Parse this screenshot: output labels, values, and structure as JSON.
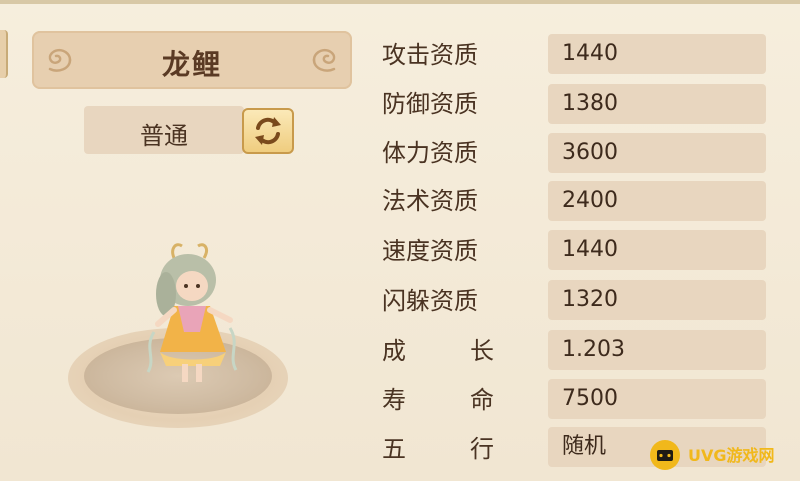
{
  "pet": {
    "name": "龙鲤",
    "quality": "普通"
  },
  "stats": [
    {
      "label": "攻击资质",
      "value": "1440"
    },
    {
      "label": "防御资质",
      "value": "1380"
    },
    {
      "label": "体力资质",
      "value": "3600"
    },
    {
      "label": "法术资质",
      "value": "2400"
    },
    {
      "label": "速度资质",
      "value": "1440"
    },
    {
      "label": "闪躲资质",
      "value": "1320"
    },
    {
      "label_a": "成",
      "label_b": "长",
      "value": "1.203"
    },
    {
      "label_a": "寿",
      "label_b": "命",
      "value": "7500"
    },
    {
      "label_a": "五",
      "label_b": "行",
      "value": "随机"
    }
  ],
  "watermark": {
    "text": "UVG游戏网",
    "color": "#f1b81b"
  },
  "colors": {
    "background": "#f3ead8",
    "field": "#e8d6bf",
    "text": "#4a3322",
    "button_gold": "#efcd7f"
  },
  "icons": {
    "refresh": "refresh-icon",
    "watermark_logo": "gamepad-icon"
  }
}
